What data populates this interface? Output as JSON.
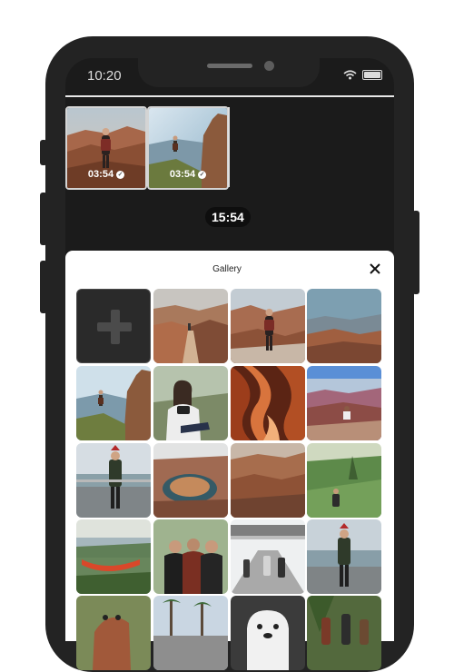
{
  "status_bar": {
    "time": "10:20"
  },
  "timeline": {
    "clips": [
      {
        "duration": "03:54",
        "icon": "check-circle-icon"
      },
      {
        "duration": "03:54",
        "icon": "check-circle-icon"
      }
    ],
    "total_duration": "15:54"
  },
  "gallery": {
    "title": "Gallery",
    "close_icon": "close-icon",
    "add_icon": "plus-icon",
    "photos": [
      "canyon-trail-stairs",
      "hiker-canyon-overlook",
      "canyon-panorama",
      "hiker-canyon-sunlight",
      "woman-sitting-rocks",
      "antelope-canyon",
      "person-sitting-canyon-edge",
      "man-on-boardwalk",
      "horseshoe-bend",
      "canyon-valley",
      "backpacker-green-valley",
      "hammock-lake",
      "group-of-friends",
      "friends-walking-street",
      "man-by-lake",
      "dog-in-grass",
      "palm-trees-street",
      "white-dog",
      "people-in-forest"
    ]
  }
}
